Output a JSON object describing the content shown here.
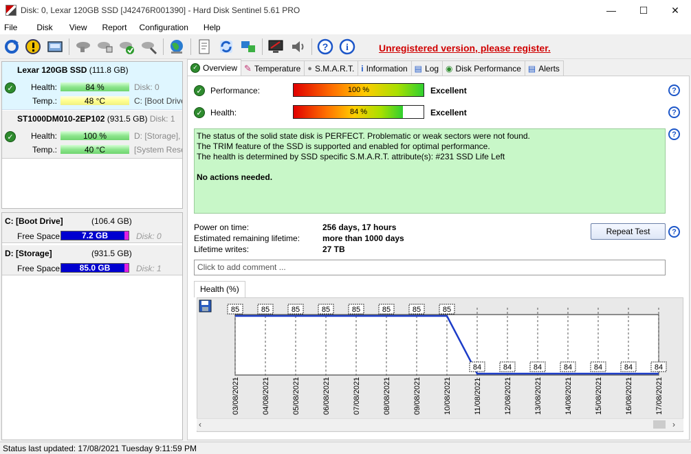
{
  "window": {
    "title": "Disk: 0, Lexar 120GB SSD [J42476R001390]  -  Hard Disk Sentinel 5.61 PRO"
  },
  "menu": [
    "File",
    "Disk",
    "View",
    "Report",
    "Configuration",
    "Help"
  ],
  "toolbar": {
    "unregistered": "Unregistered version, please register."
  },
  "disks": [
    {
      "name": "Lexar 120GB SSD",
      "size": "(111.8 GB)",
      "health_label": "Health:",
      "health": "84 %",
      "health_pct": 84,
      "temp_label": "Temp.:",
      "temp": "48 °C",
      "side1": "Disk: 0",
      "side2": "C: [Boot Drive"
    },
    {
      "name": "ST1000DM010-2EP102",
      "size": "(931.5 GB)",
      "index": "Disk: 1",
      "health_label": "Health:",
      "health": "100 %",
      "health_pct": 100,
      "temp_label": "Temp.:",
      "temp": "40 °C",
      "side1": "D: [Storage],",
      "side2": "[System Rese"
    }
  ],
  "volumes": [
    {
      "name": "C: [Boot Drive]",
      "size": "(106.4 GB)",
      "free_label": "Free Space",
      "free": "7.2 GB",
      "disk": "Disk: 0"
    },
    {
      "name": "D: [Storage]",
      "size": "(931.5 GB)",
      "free_label": "Free Space",
      "free": "85.0 GB",
      "disk": "Disk: 1"
    }
  ],
  "tabs": [
    "Overview",
    "Temperature",
    "S.M.A.R.T.",
    "Information",
    "Log",
    "Disk Performance",
    "Alerts"
  ],
  "overview": {
    "performance_label": "Performance:",
    "performance_value": "100 %",
    "performance_pct": 100,
    "performance_verdict": "Excellent",
    "health_label": "Health:",
    "health_value": "84 %",
    "health_pct": 84,
    "health_verdict": "Excellent",
    "status_lines": [
      "The status of the solid state disk is PERFECT. Problematic or weak sectors were not found.",
      "The TRIM feature of the SSD is supported and enabled for optimal performance.",
      "The health is determined by SSD specific S.M.A.R.T. attribute(s):  #231 SSD Life Left"
    ],
    "no_action": "No actions needed.",
    "power_on_label": "Power on time:",
    "power_on_value": "256 days, 17 hours",
    "remaining_label": "Estimated remaining lifetime:",
    "remaining_value": "more than 1000 days",
    "writes_label": "Lifetime writes:",
    "writes_value": "27 TB",
    "repeat_test": "Repeat Test",
    "comment_placeholder": "Click to add comment ..."
  },
  "chart_tab": "Health (%)",
  "chart_data": {
    "type": "line",
    "x": [
      "03/08/2021",
      "04/08/2021",
      "05/08/2021",
      "06/08/2021",
      "07/08/2021",
      "08/08/2021",
      "09/08/2021",
      "10/08/2021",
      "11/08/2021",
      "12/08/2021",
      "13/08/2021",
      "14/08/2021",
      "15/08/2021",
      "16/08/2021",
      "17/08/2021"
    ],
    "values": [
      85,
      85,
      85,
      85,
      85,
      85,
      85,
      85,
      84,
      84,
      84,
      84,
      84,
      84,
      84
    ],
    "ylim": [
      84,
      85
    ],
    "color": "#1c3cc8"
  },
  "statusbar": "Status last updated: 17/08/2021 Tuesday 9:11:59 PM"
}
